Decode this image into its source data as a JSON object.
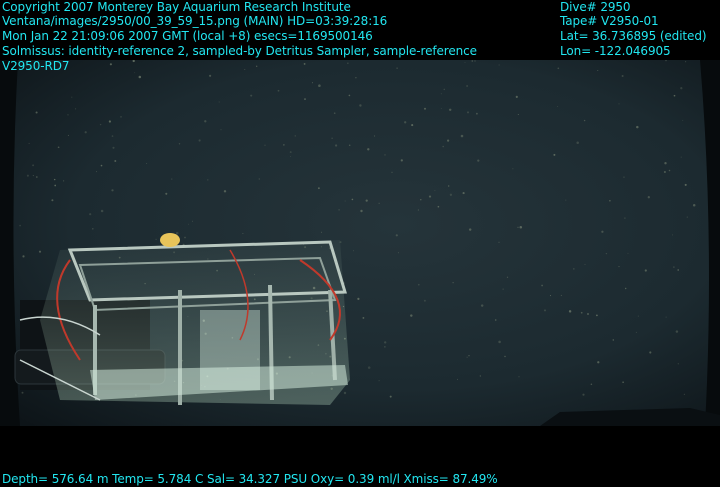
{
  "header_left": {
    "line1": "Copyright 2007 Monterey Bay Aquarium Research Institute",
    "line2": "Ventana/images/2950/00_39_59_15.png (MAIN)  HD=03:39:28:16",
    "line3": "Mon Jan 22 21:09:06 2007 GMT (local +8)  esecs=1169500146",
    "line4": "Solmissus: identity-reference 2, sampled-by Detritus Sampler, sample-reference",
    "line5": "V2950-RD7"
  },
  "header_right": {
    "dive": "Dive# 2950",
    "tape": "Tape# V2950-01",
    "lat": "Lat= 36.736895 (edited)",
    "lon": "Lon= -122.046905"
  },
  "footer": {
    "sensors": "Depth= 576.64 m  Temp= 5.784 C  Sal= 34.327 PSU  Oxy= 0.39 ml/l  Xmiss= 87.49%"
  },
  "colors": {
    "overlay_text": "#22e6f0",
    "water": "#1c2a30",
    "sampler_frame": "#b9c8c0",
    "hose": "#c0392b"
  }
}
